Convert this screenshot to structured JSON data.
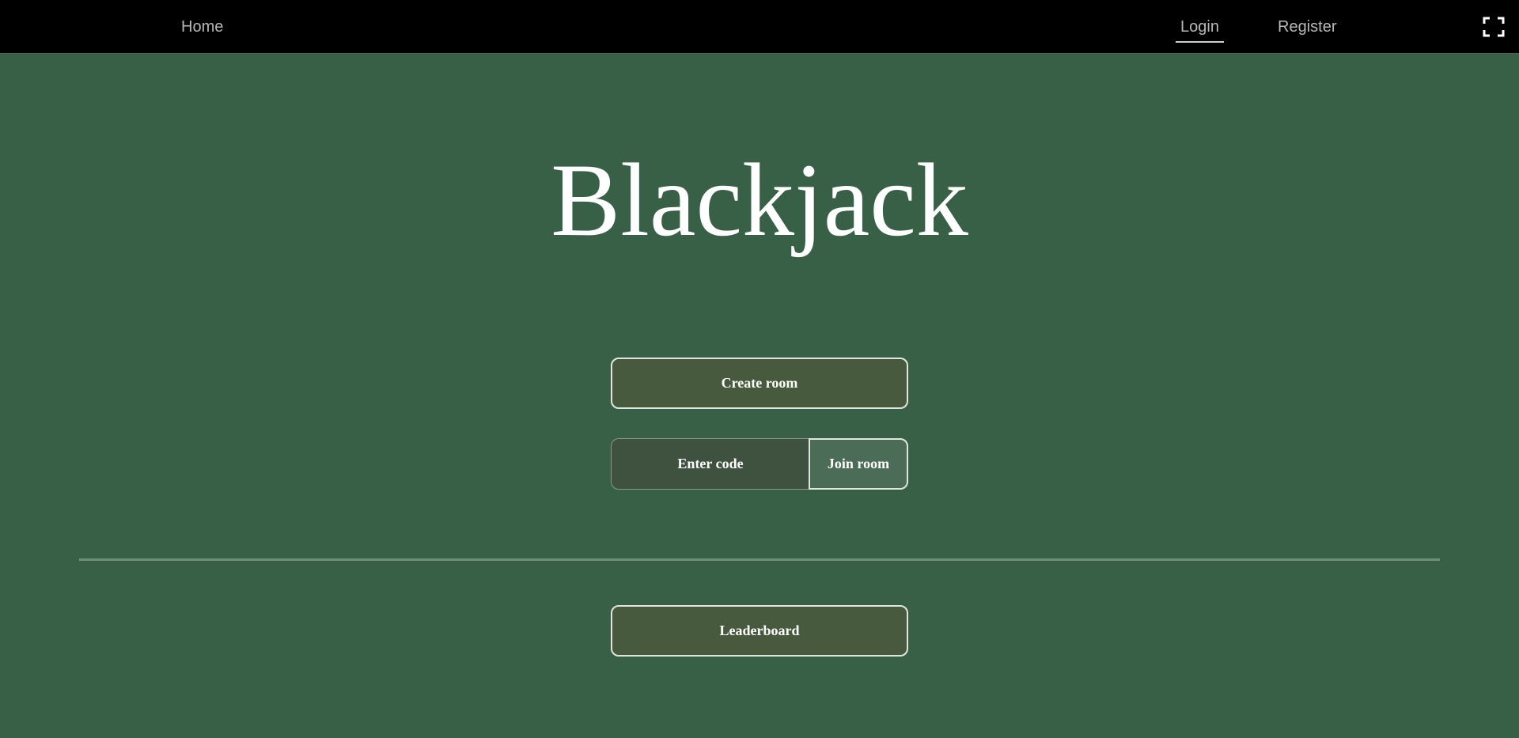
{
  "nav": {
    "home_label": "Home",
    "login_label": "Login",
    "register_label": "Register",
    "fullscreen_icon": "fullscreen-icon"
  },
  "main": {
    "title": "Blackjack",
    "create_room_label": "Create room",
    "code_placeholder": "Enter code",
    "code_value": "",
    "join_room_label": "Join room",
    "leaderboard_label": "Leaderboard"
  },
  "colors": {
    "background": "#386047",
    "navbar": "#000000",
    "button_fill": "#485a3d",
    "join_fill": "#4b6c56",
    "text": "#ffffff"
  }
}
